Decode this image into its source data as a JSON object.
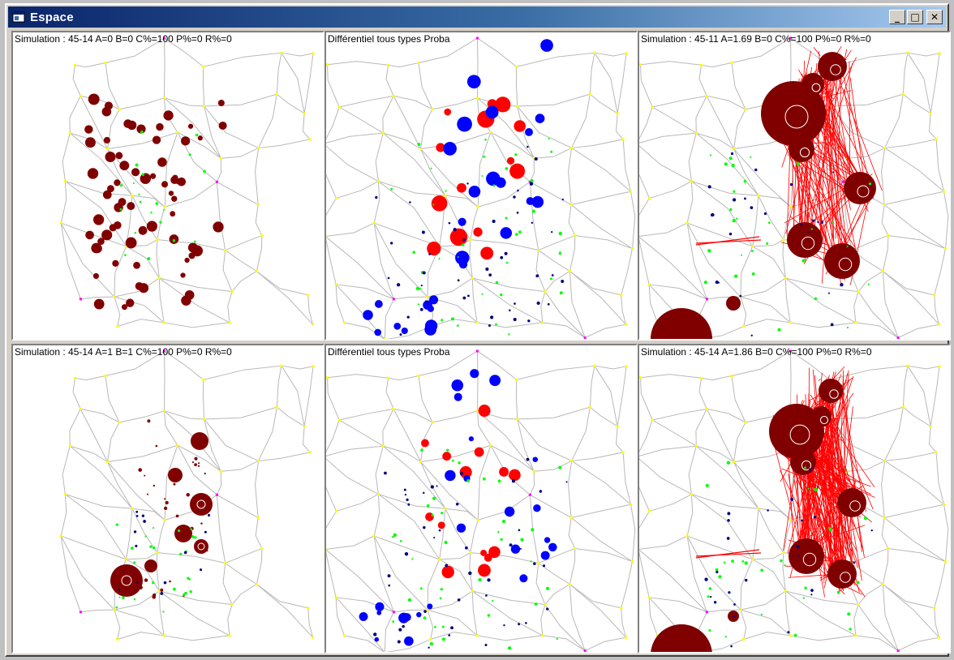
{
  "window": {
    "title": "Espace",
    "minimize_label": "_",
    "maximize_label": "□",
    "close_label": "✕"
  },
  "panels": [
    {
      "id": "sim-a0",
      "label": "Simulation : 45-14 A=0 B=0 C%=100 P%=0 R%=0",
      "type": "dots"
    },
    {
      "id": "diff-1",
      "label": "Différentiel tous types Proba",
      "type": "diff"
    },
    {
      "id": "sim-a169",
      "label": "Simulation : 45-11 A=1.69 B=0 C%=100 P%=0 R%=0",
      "type": "links"
    },
    {
      "id": "sim-a1",
      "label": "Simulation : 45-14 A=1 B=1 C%=100 P%=0 R%=0",
      "type": "mixed"
    },
    {
      "id": "diff-2",
      "label": "Différentiel tous types Proba",
      "type": "diff"
    },
    {
      "id": "sim-a186",
      "label": "Simulation : 45-14 A=1.86 B=0 C%=100 P%=0 R%=0",
      "type": "links"
    }
  ],
  "colors": {
    "network": "#b8b8b8",
    "node": "#ffff00",
    "node_special": "#ff00ff",
    "settlement": "#800000",
    "positive": "#ff0000",
    "negative": "#0000ff",
    "small_green": "#00ff00",
    "small_navy": "#000080",
    "links": "#ff0000"
  }
}
